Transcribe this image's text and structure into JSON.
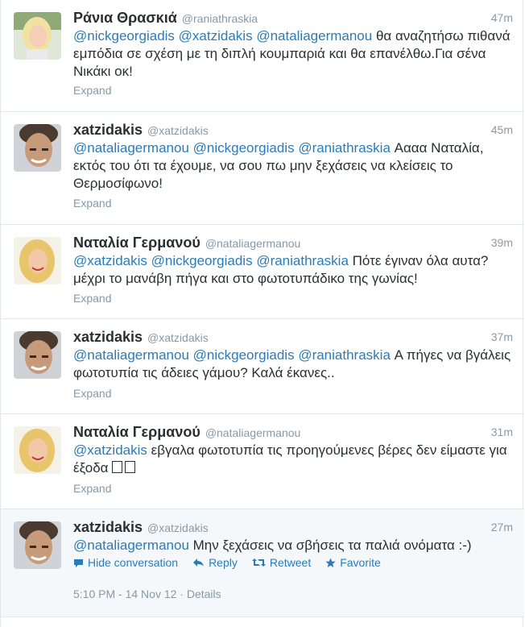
{
  "tweets": [
    {
      "name": "Ράνια Θρασκιά",
      "handle": "@raniathraskia",
      "time": "47m",
      "mentions": [
        "@nickgeorgiadis",
        "@xatzidakis",
        "@nataliagermanou"
      ],
      "text": "θα αναζητήσω πιθανά εμπόδια σε σχέση με τη διπλή κουμπαριά και θα επανέλθω.Για σένα Νικάκι οκ!",
      "expand": "Expand"
    },
    {
      "name": "xatzidakis",
      "handle": "@xatzidakis",
      "time": "45m",
      "mentions": [
        "@nataliagermanou",
        "@nickgeorgiadis",
        "@raniathraskia"
      ],
      "text": "Αααα Ναταλία, εκτός του ότι τα έχουμε, να σου πω μην ξεχάσεις να κλείσεις το Θερμοσίφωνο!",
      "expand": "Expand"
    },
    {
      "name": "Ναταλία Γερμανού",
      "handle": "@nataliagermanou",
      "time": "39m",
      "mentions": [
        "@xatzidakis",
        "@nickgeorgiadis",
        "@raniathraskia"
      ],
      "text": "Πότε έγιναν όλα αυτα? μέχρι το μανάβη πήγα και στο φωτοτυπάδικο της γωνίας!",
      "expand": "Expand"
    },
    {
      "name": "xatzidakis",
      "handle": "@xatzidakis",
      "time": "37m",
      "mentions": [
        "@nataliagermanou",
        "@nickgeorgiadis",
        "@raniathraskia"
      ],
      "text": "Α πήγες να βγάλεις φωτοτυπία τις άδειες γάμου? Καλά έκανες..",
      "expand": "Expand"
    },
    {
      "name": "Ναταλία Γερμανού",
      "handle": "@nataliagermanou",
      "time": "31m",
      "mentions": [
        "@xatzidakis"
      ],
      "text": "εβγαλα φωτοτυπία τις προηγούμενες βέρες δεν είμαστε για έξοδα",
      "expand": "Expand"
    },
    {
      "name": "xatzidakis",
      "handle": "@xatzidakis",
      "time": "27m",
      "mentions": [
        "@nataliagermanou"
      ],
      "text": "Μην ξεχάσεις να σβήσεις τα παλιά ονόματα :-)",
      "actions": {
        "hide_conversation": "Hide conversation",
        "reply": "Reply",
        "retweet": "Retweet",
        "favorite": "Favorite"
      },
      "meta": {
        "timestamp": "5:10 PM - 14 Nov 12",
        "separator": "·",
        "details": "Details"
      }
    }
  ],
  "colors": {
    "link": "#2b7bb9",
    "muted": "#8899a6",
    "text": "#292f33",
    "border": "#e1e8ed"
  },
  "icons": {
    "hide_conversation": "speech-bubble-icon",
    "reply": "reply-arrow-icon",
    "retweet": "retweet-icon",
    "favorite": "star-icon"
  }
}
